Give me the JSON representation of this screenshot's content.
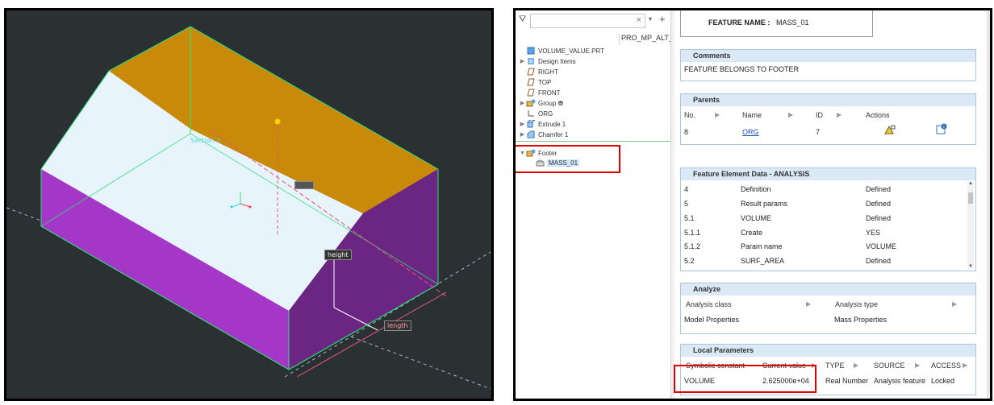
{
  "viewport": {
    "labels": {
      "section": "Section 1",
      "height": "height",
      "length": "length"
    },
    "colors": {
      "top_face": "#c98a0a",
      "front_face": "#a437c7",
      "side_face": "#6b2583",
      "slope_face": "#e8f4fb",
      "background": "#2b3033"
    }
  },
  "tree": {
    "column_header": "PRO_MP_ALT_I",
    "items": [
      {
        "label": "VOLUME_VALUE.PRT",
        "icon": "part-icon"
      },
      {
        "label": "Design Items",
        "icon": "design-items-icon"
      },
      {
        "label": "RIGHT",
        "icon": "datum-plane-icon"
      },
      {
        "label": "TOP",
        "icon": "datum-plane-icon"
      },
      {
        "label": "FRONT",
        "icon": "datum-plane-icon"
      },
      {
        "label": "Group ⛃",
        "icon": "group-icon"
      },
      {
        "label": "ORG",
        "icon": "csys-icon"
      },
      {
        "label": "Extrude 1",
        "icon": "extrude-icon"
      },
      {
        "label": "Chamfer 1",
        "icon": "chamfer-icon"
      },
      {
        "label": "Footer",
        "icon": "footer-group-icon"
      },
      {
        "label": "MASS_01",
        "icon": "analysis-feature-icon"
      }
    ]
  },
  "feature_name": {
    "label": "FEATURE NAME :",
    "value": "MASS_01"
  },
  "comments": {
    "title": "Comments",
    "text": "FEATURE BELONGS TO FOOTER"
  },
  "parents": {
    "title": "Parents",
    "headers": [
      "No.",
      "Name",
      "ID",
      "Actions"
    ],
    "row": {
      "no": "8",
      "name": "ORG",
      "id": "7"
    }
  },
  "feature_element": {
    "title": "Feature Element Data - ANALYSIS",
    "rows": [
      [
        "4",
        "Definition",
        "Defined"
      ],
      [
        "5",
        "Result params",
        "Defined"
      ],
      [
        "5.1",
        "VOLUME",
        "Defined"
      ],
      [
        "5.1.1",
        "Create",
        "YES"
      ],
      [
        "5.1.2",
        "Param name",
        "VOLUME"
      ],
      [
        "5.2",
        "SURF_AREA",
        "Defined"
      ]
    ]
  },
  "analyze": {
    "title": "Analyze",
    "headers": [
      "Analysis class",
      "Analysis type"
    ],
    "values": [
      "Model Properties",
      "Mass Properties"
    ]
  },
  "local_parameters": {
    "title": "Local Parameters",
    "headers": [
      "Symbolic constant",
      "Current value",
      "TYPE",
      "SOURCE",
      "ACCESS"
    ],
    "row": [
      "VOLUME",
      "2.625000e+04",
      "Real Number",
      "Analysis feature",
      "Locked"
    ]
  }
}
